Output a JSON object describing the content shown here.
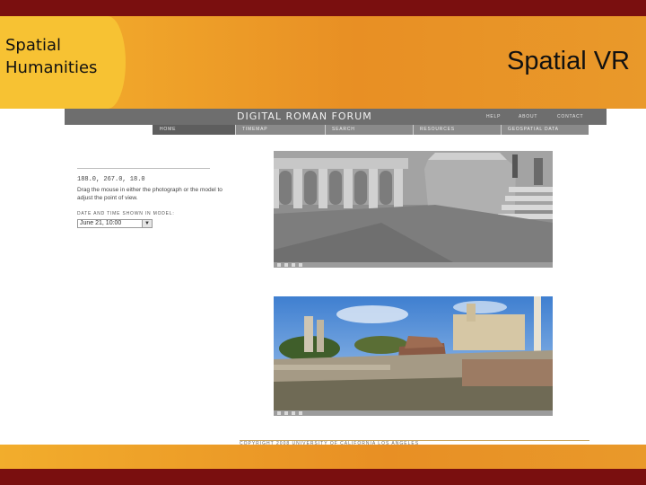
{
  "slide": {
    "corner_title": "Spatial Humanities",
    "title": "Spatial VR"
  },
  "site": {
    "title": "DIGITAL ROMAN FORUM",
    "top_links": [
      "HELP",
      "ABOUT",
      "CONTACT"
    ],
    "nav": [
      "HOME",
      "TIMEMAP",
      "SEARCH",
      "RESOURCES",
      "GEOSPATIAL DATA"
    ],
    "coordinates": "188.0, 267.0, 18.0",
    "instructions": "Drag the mouse in either the photograph or the model to adjust the point of view.",
    "date_label": "DATE AND TIME SHOWN IN MODEL:",
    "date_value": "June 21, 10:00",
    "copyright": "COPYRIGHT 2008 UNIVERSITY OF CALIFORNIA LOS ANGELES"
  },
  "colors": {
    "brand_dark_red": "#7a0f0f",
    "band_orange": "#e88f24",
    "tab_yellow": "#f7c233",
    "site_header": "#6e6e6e"
  },
  "icons": {
    "date_dropdown": "chevron-down-icon",
    "viewer_controls": [
      "play-icon",
      "zoom-in-icon",
      "zoom-out-icon",
      "fullscreen-icon"
    ]
  }
}
